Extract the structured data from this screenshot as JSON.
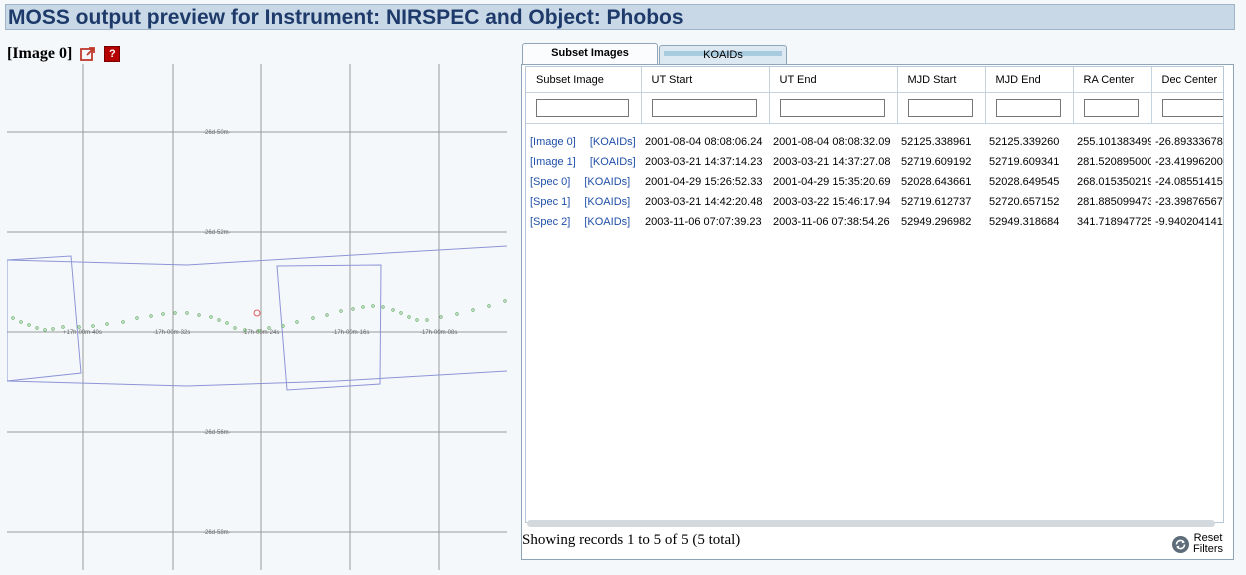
{
  "page": {
    "title": "MOSS output preview for Instrument: NIRSPEC and Object: Phobos"
  },
  "image_panel": {
    "label": "[Image 0]",
    "icons": [
      "external-link-icon",
      "help-icon"
    ],
    "help_symbol": "?",
    "dec_labels": [
      "-26d-50m-",
      "-26d-52m-",
      "-26d-56m-",
      "-26d-58m-"
    ],
    "ra_labels": [
      "+17h-00m-40s",
      "-17h-00m-32s",
      "-17h-00m-24s",
      "-17h-00m-16s",
      "-17h-00m-08s"
    ]
  },
  "tabs": [
    {
      "label": "Subset Images",
      "active": true
    },
    {
      "label": "KOAIDs",
      "active": false
    }
  ],
  "table": {
    "columns": [
      "Subset Image",
      "UT Start",
      "UT End",
      "MJD Start",
      "MJD End",
      "RA Center",
      "Dec Center"
    ],
    "rows": [
      {
        "link": "[Image 0]",
        "koaid": "[KOAIDs]",
        "ut_start": "2001-08-04 08:08:06.24",
        "ut_end": "2001-08-04 08:08:32.09",
        "mjd_start": "52125.338961",
        "mjd_end": "52125.339260",
        "ra": "255.101383499",
        "dec": "-26.89333678"
      },
      {
        "link": "[Image 1]",
        "koaid": "[KOAIDs]",
        "ut_start": "2003-03-21 14:37:14.23",
        "ut_end": "2003-03-21 14:37:27.08",
        "mjd_start": "52719.609192",
        "mjd_end": "52719.609341",
        "ra": "281.520895000",
        "dec": "-23.41996200"
      },
      {
        "link": "[Spec 0]",
        "koaid": "[KOAIDs]",
        "ut_start": "2001-04-29 15:26:52.33",
        "ut_end": "2001-04-29 15:35:20.69",
        "mjd_start": "52028.643661",
        "mjd_end": "52028.649545",
        "ra": "268.015350219",
        "dec": "-24.08551415"
      },
      {
        "link": "[Spec 1]",
        "koaid": "[KOAIDs]",
        "ut_start": "2003-03-21 14:42:20.48",
        "ut_end": "2003-03-22 15:46:17.94",
        "mjd_start": "52719.612737",
        "mjd_end": "52720.657152",
        "ra": "281.885099473",
        "dec": "-23.39876567"
      },
      {
        "link": "[Spec 2]",
        "koaid": "[KOAIDs]",
        "ut_start": "2003-11-06 07:07:39.23",
        "ut_end": "2003-11-06 07:38:54.26",
        "mjd_start": "52949.296982",
        "mjd_end": "52949.318684",
        "ra": "341.718947725",
        "dec": "-9.940204141"
      }
    ]
  },
  "status": {
    "text": "Showing records 1 to 5 of 5 (5 total)",
    "reset_label_1": "Reset",
    "reset_label_2": "Filters"
  },
  "colors": {
    "title_bg": "#c8d8e6",
    "title_text": "#1d3a6a",
    "link": "#1f4fa8",
    "footprint": "#8c95d6",
    "track_points": "#6ab06a",
    "target_marker": "#e06060"
  }
}
